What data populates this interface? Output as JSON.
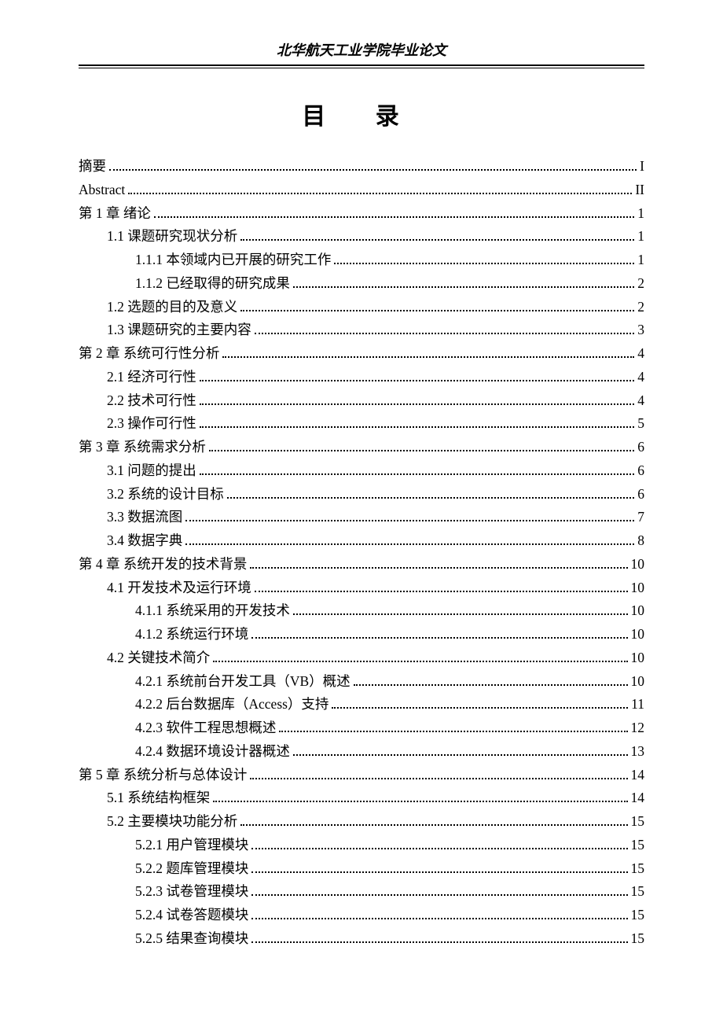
{
  "header": "北华航天工业学院毕业论文",
  "title": "目 录",
  "toc": [
    {
      "level": 0,
      "label": "摘要",
      "page": "I"
    },
    {
      "level": 0,
      "label": "Abstract",
      "page": "II"
    },
    {
      "level": 0,
      "label": "第 1 章  绪论",
      "page": "1"
    },
    {
      "level": 1,
      "label": "1.1  课题研究现状分析",
      "page": "1"
    },
    {
      "level": 2,
      "label": "1.1.1  本领域内已开展的研究工作",
      "page": "1"
    },
    {
      "level": 2,
      "label": "1.1.2  已经取得的研究成果",
      "page": "2"
    },
    {
      "level": 1,
      "label": "1.2  选题的目的及意义",
      "page": "2"
    },
    {
      "level": 1,
      "label": "1.3  课题研究的主要内容",
      "page": "3"
    },
    {
      "level": 0,
      "label": "第 2 章  系统可行性分析",
      "page": "4"
    },
    {
      "level": 1,
      "label": "2.1  经济可行性",
      "page": "4"
    },
    {
      "level": 1,
      "label": "2.2  技术可行性",
      "page": "4"
    },
    {
      "level": 1,
      "label": "2.3  操作可行性",
      "page": "5"
    },
    {
      "level": 0,
      "label": "第 3 章  系统需求分析",
      "page": "6"
    },
    {
      "level": 1,
      "label": "3.1  问题的提出",
      "page": "6"
    },
    {
      "level": 1,
      "label": "3.2  系统的设计目标",
      "page": "6"
    },
    {
      "level": 1,
      "label": "3.3  数据流图",
      "page": "7"
    },
    {
      "level": 1,
      "label": "3.4  数据字典",
      "page": "8"
    },
    {
      "level": 0,
      "label": "第 4 章  系统开发的技术背景",
      "page": "10"
    },
    {
      "level": 1,
      "label": "4.1  开发技术及运行环境",
      "page": "10"
    },
    {
      "level": 2,
      "label": "4.1.1  系统采用的开发技术",
      "page": "10"
    },
    {
      "level": 2,
      "label": "4.1.2  系统运行环境",
      "page": "10"
    },
    {
      "level": 1,
      "label": "4.2  关键技术简介",
      "page": "10"
    },
    {
      "level": 2,
      "label": "4.2.1  系统前台开发工具（VB）概述",
      "page": "10"
    },
    {
      "level": 2,
      "label": "4.2.2  后台数据库（Access）支持",
      "page": "11"
    },
    {
      "level": 2,
      "label": "4.2.3  软件工程思想概述",
      "page": "12"
    },
    {
      "level": 2,
      "label": "4.2.4  数据环境设计器概述",
      "page": "13"
    },
    {
      "level": 0,
      "label": "第 5 章  系统分析与总体设计",
      "page": "14"
    },
    {
      "level": 1,
      "label": "5.1  系统结构框架",
      "page": "14"
    },
    {
      "level": 1,
      "label": "5.2  主要模块功能分析",
      "page": "15"
    },
    {
      "level": 2,
      "label": "5.2.1  用户管理模块",
      "page": "15"
    },
    {
      "level": 2,
      "label": "5.2.2  题库管理模块",
      "page": "15"
    },
    {
      "level": 2,
      "label": "5.2.3  试卷管理模块",
      "page": "15"
    },
    {
      "level": 2,
      "label": "5.2.4  试卷答题模块",
      "page": "15"
    },
    {
      "level": 2,
      "label": "5.2.5  结果查询模块",
      "page": "15"
    }
  ]
}
